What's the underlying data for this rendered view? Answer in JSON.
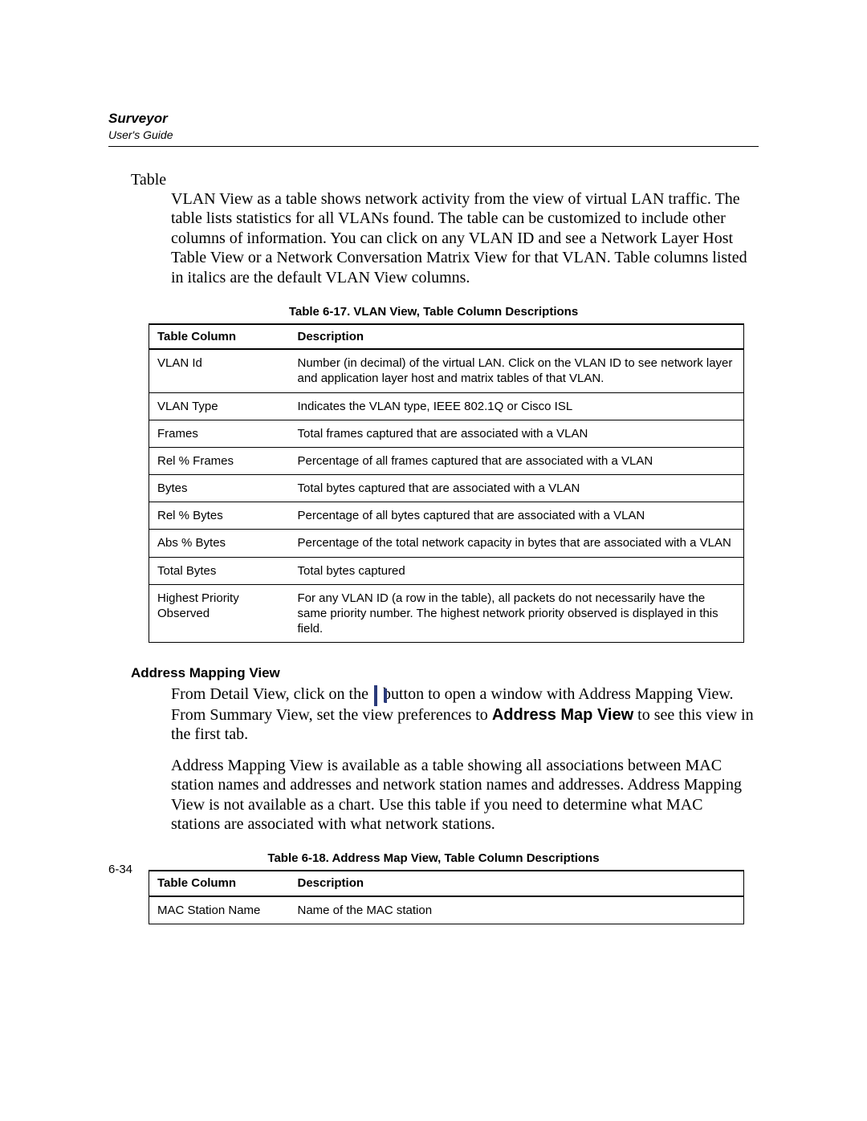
{
  "header": {
    "brand": "Surveyor",
    "subtitle": "User's Guide"
  },
  "section1": {
    "heading": "Table",
    "paragraph": "VLAN View as a table shows network activity from the view of virtual LAN traffic. The table lists statistics for all VLANs found. The table can be customized to include other columns of information. You can click on any VLAN ID and see a Network Layer Host Table View or a Network Conversation Matrix View for that VLAN. Table columns listed in italics are the default VLAN View columns."
  },
  "table1": {
    "caption": "Table 6-17. VLAN View, Table Column Descriptions",
    "headers": {
      "c1": "Table Column",
      "c2": "Description"
    },
    "rows": [
      {
        "c1": "VLAN Id",
        "c2": "Number (in decimal) of the virtual LAN. Click on the VLAN ID to see network layer and application layer host and matrix tables of that VLAN."
      },
      {
        "c1": "VLAN Type",
        "c2": "Indicates the VLAN type, IEEE 802.1Q or Cisco ISL"
      },
      {
        "c1": "Frames",
        "c2": "Total frames captured that are associated with a VLAN"
      },
      {
        "c1": "Rel % Frames",
        "c2": "Percentage of all frames captured that are associated with a VLAN"
      },
      {
        "c1": "Bytes",
        "c2": "Total bytes captured that are associated with a VLAN"
      },
      {
        "c1": "Rel % Bytes",
        "c2": "Percentage of all bytes captured that are associated with a VLAN"
      },
      {
        "c1": "Abs % Bytes",
        "c2": "Percentage of the total network capacity in bytes that are associated with a VLAN"
      },
      {
        "c1": "Total Bytes",
        "c2": "Total bytes captured"
      },
      {
        "c1": "Highest Priority Observed",
        "c2": "For any VLAN ID (a row in the table), all packets do not necessarily have the same priority number. The highest network priority observed is displayed in this field."
      }
    ]
  },
  "section2": {
    "heading": "Address Mapping View",
    "p1_a": "From Detail View, click on the ",
    "p1_b": " button to open a window with Address Mapping View. From Summary View, set the view preferences to ",
    "p1_bold": "Address Map View",
    "p1_c": " to see this view in the first tab.",
    "p2": "Address Mapping View is available as a table showing all associations between MAC station names and addresses and network station names and addresses. Address Mapping View is not available as a chart. Use this table if you need to determine what MAC stations are associated with what network stations."
  },
  "table2": {
    "caption": "Table 6-18. Address Map View, Table Column Descriptions",
    "headers": {
      "c1": "Table Column",
      "c2": "Description"
    },
    "rows": [
      {
        "c1": "MAC Station Name",
        "c2": "Name of the MAC station"
      }
    ]
  },
  "page_number": "6-34"
}
